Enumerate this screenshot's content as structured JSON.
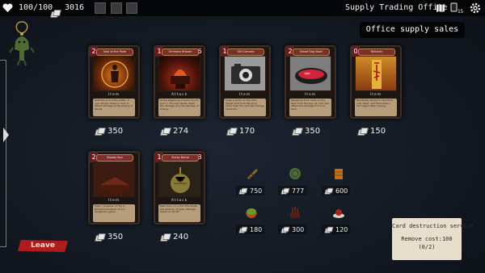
{
  "topbar": {
    "health": "100/100",
    "money": "3016",
    "location": "Supply Trading Office",
    "deck_count": "15"
  },
  "heading": "Office supply sales",
  "cards": [
    {
      "cost": "2",
      "cost2": "",
      "name": "Seal of the Palm",
      "type": "Item",
      "desc": "Until the end of the battle, if your sticker draws a card, it attack damage to the enemy in hands.",
      "price": "350",
      "art": "#a24a12"
    },
    {
      "cost": "1",
      "cost2": "6",
      "name": "Ominous Brazier",
      "type": "Attack",
      "desc": "At the beginning of each round, burn x. The red candle deals the damage and the damage of enemy.",
      "price": "274",
      "art": "#7a1d10"
    },
    {
      "cost": "1",
      "cost2": "",
      "name": "Old Camera",
      "type": "Item",
      "desc": "Snap a photo on the card. Target card from the shop hand, then the card will change randomly.",
      "price": "170",
      "art": "#6d6d6d"
    },
    {
      "cost": "2",
      "cost2": "",
      "name": "Blood Dog Bowl",
      "type": "Item",
      "desc": "Randomly fill 4 cards on the deck from the top; x4 cost card attack the damage if it is an item.",
      "price": "350",
      "art": "#a3232e"
    },
    {
      "cost": "0",
      "cost2": "",
      "name": "Talisman",
      "type": "Item",
      "desc": "Randomly discard 1 card from your hand, and then draw 1 card again after cursing.",
      "price": "150",
      "art": "#9b5a18"
    },
    {
      "cost": "2",
      "cost2": "",
      "name": "Bloody Box",
      "type": "Item",
      "desc": "Type: 'I surprise !!!' Try a Randomized Deck. It is a dangerous game.",
      "price": "350",
      "art": "#5a2a1a"
    },
    {
      "cost": "1",
      "cost2": "3",
      "name": "Sticky Bomb",
      "type": "Attack",
      "desc": "Each turn, -1, x 3/4. The bomb will explode, it deals damage based on its HP.",
      "price": "240",
      "art": "#6a5a2a"
    }
  ],
  "items": [
    {
      "price": "750",
      "color": "#8a6a2c"
    },
    {
      "price": "777",
      "color": "#4b6b3a"
    },
    {
      "price": "600",
      "color": "#c2701b"
    },
    {
      "price": "180",
      "color": "#6a9a2a"
    },
    {
      "price": "300",
      "color": "#8a2e1c"
    },
    {
      "price": "120",
      "color": "#a8261e"
    }
  ],
  "destruction": {
    "title": "Card destruction service",
    "cost": "Remove cost:100",
    "count": "(0/2)"
  },
  "leave_label": "Leave"
}
